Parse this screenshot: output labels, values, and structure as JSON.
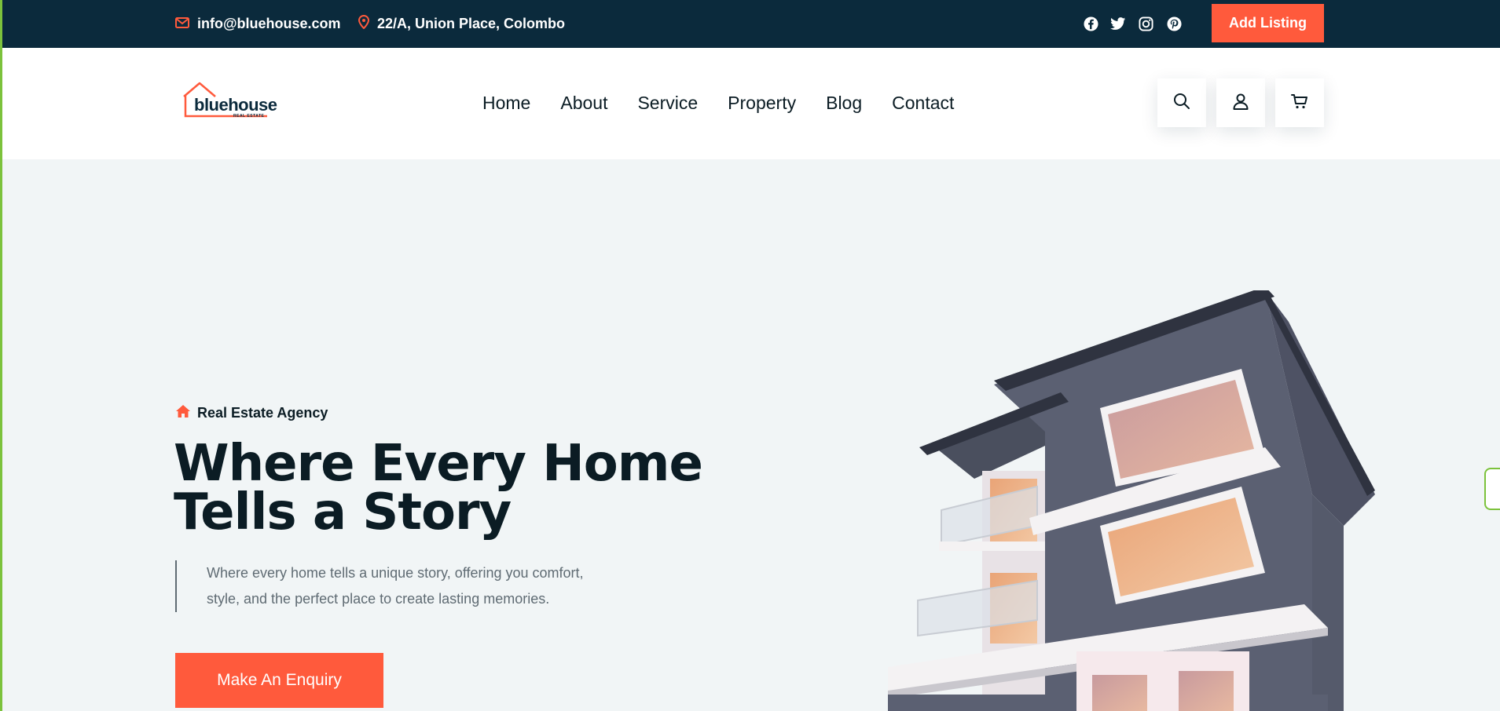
{
  "topbar": {
    "email": "info@bluehouse.com",
    "address": "22/A, Union Place, Colombo",
    "social": [
      "facebook-icon",
      "twitter-icon",
      "instagram-icon",
      "pinterest-icon"
    ],
    "add_listing_label": "Add Listing"
  },
  "header": {
    "logo": {
      "name": "bluehouse",
      "subtitle": "REAL ESTATE"
    },
    "nav": [
      "Home",
      "About",
      "Service",
      "Property",
      "Blog",
      "Contact"
    ],
    "icons": [
      "search-icon",
      "user-icon",
      "cart-icon"
    ]
  },
  "hero": {
    "tagline": "Real Estate Agency",
    "title_line1": "Where Every Home",
    "title_line2": "Tells a Story",
    "description_line1": "Where every home tells a unique story, offering you comfort,",
    "description_line2": "style, and the perfect place to create lasting memories.",
    "cta_label": "Make An Enquiry"
  },
  "colors": {
    "accent": "#ff5a3c",
    "dark": "#0b2a3c",
    "hero_bg": "#f1f5f6"
  }
}
